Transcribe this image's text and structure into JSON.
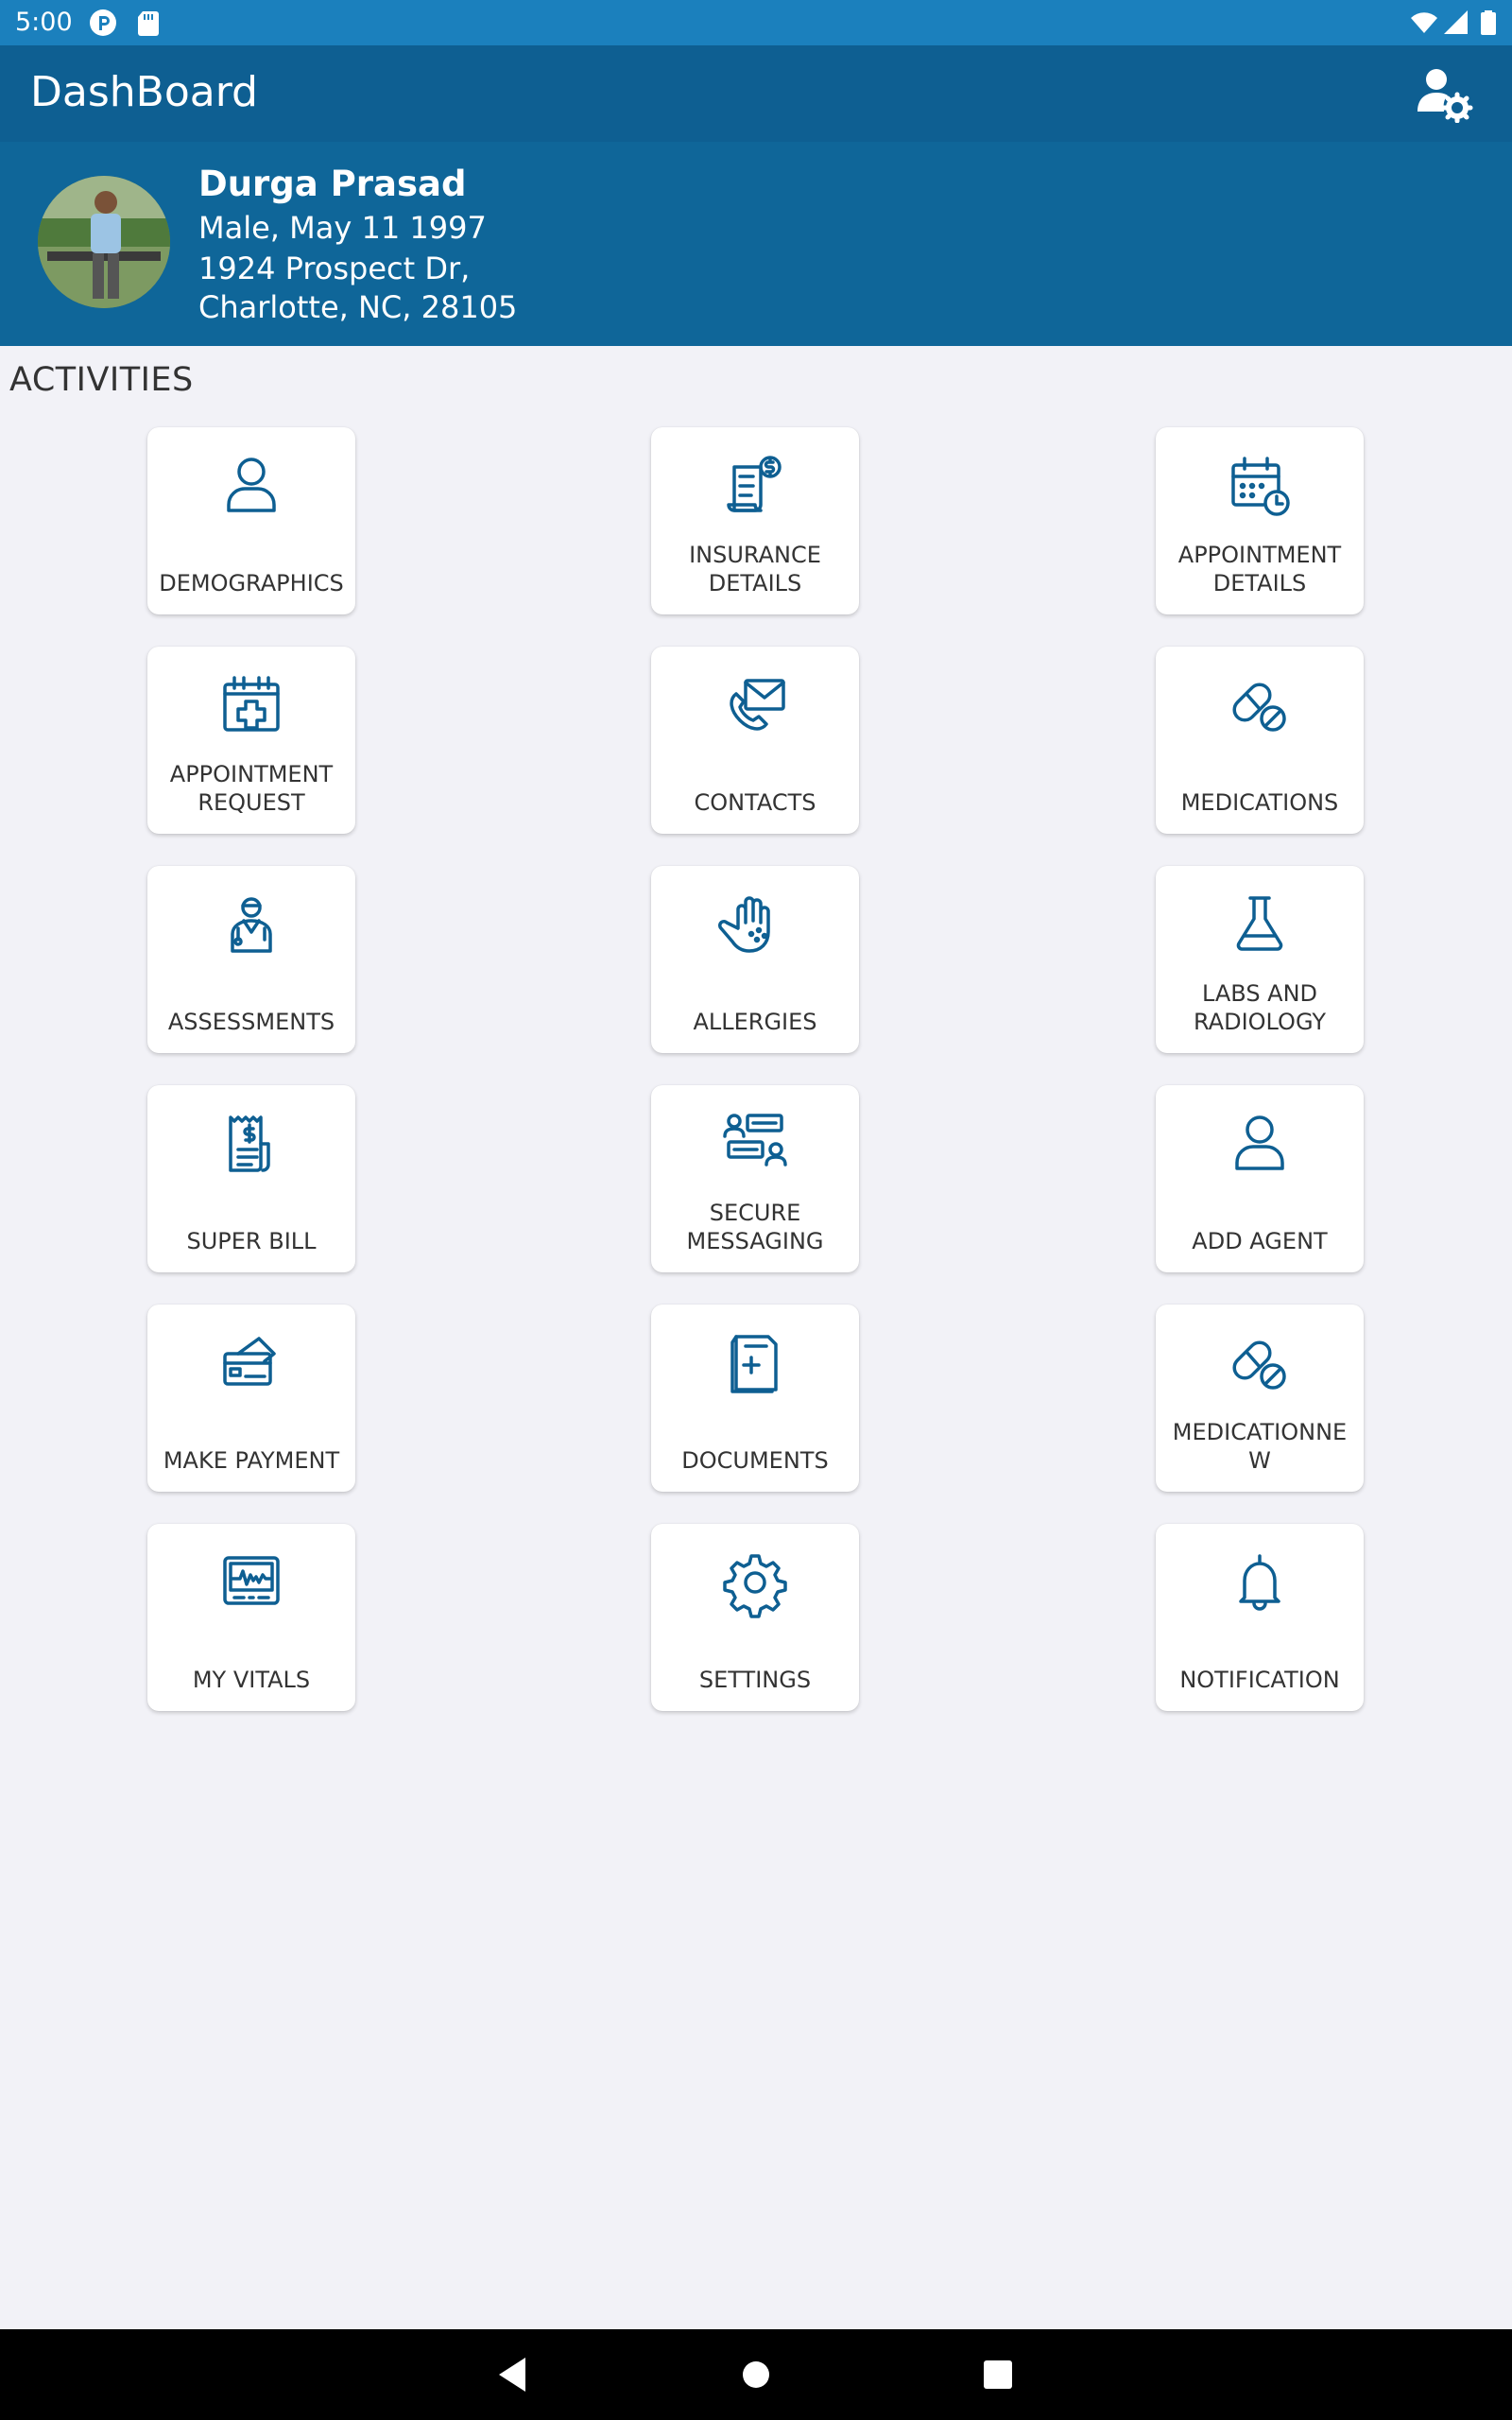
{
  "status_bar": {
    "time": "5:00",
    "left_icons": [
      "p-icon",
      "sd-card-icon"
    ],
    "right_icons": [
      "wifi-icon",
      "signal-icon",
      "battery-icon"
    ]
  },
  "app_bar": {
    "title": "DashBoard",
    "action_icon": "user-settings-icon"
  },
  "profile": {
    "name": "Durga Prasad",
    "gender_dob": "Male, May 11 1997",
    "address_line1": "1924 Prospect Dr,",
    "address_line2": "Charlotte, NC, 28105"
  },
  "activities_label": "ACTIVITIES",
  "activities": [
    {
      "label": "DEMOGRAPHICS",
      "icon": "user-icon"
    },
    {
      "label": "INSURANCE\nDETAILS",
      "icon": "insurance-icon"
    },
    {
      "label": "APPOINTMENT\nDETAILS",
      "icon": "calendar-clock-icon"
    },
    {
      "label": "APPOINTMENT\nREQUEST",
      "icon": "calendar-plus-icon"
    },
    {
      "label": "CONTACTS",
      "icon": "phone-mail-icon"
    },
    {
      "label": "MEDICATIONS",
      "icon": "pill-icon"
    },
    {
      "label": "ASSESSMENTS",
      "icon": "doctor-icon"
    },
    {
      "label": "ALLERGIES",
      "icon": "hand-icon"
    },
    {
      "label": "LABS AND\nRADIOLOGY",
      "icon": "flask-icon"
    },
    {
      "label": "SUPER BILL",
      "icon": "receipt-icon"
    },
    {
      "label": "SECURE\nMESSAGING",
      "icon": "chat-icon"
    },
    {
      "label": "ADD AGENT",
      "icon": "user-icon"
    },
    {
      "label": "MAKE PAYMENT",
      "icon": "credit-card-icon"
    },
    {
      "label": "DOCUMENTS",
      "icon": "document-icon"
    },
    {
      "label": "MEDICATIONNE\nW",
      "icon": "pill-icon"
    },
    {
      "label": "MY VITALS",
      "icon": "monitor-icon"
    },
    {
      "label": "SETTINGS",
      "icon": "gear-icon"
    },
    {
      "label": "NOTIFICATION",
      "icon": "bell-icon"
    }
  ],
  "nav_bar": {
    "icons": [
      "back-icon",
      "home-icon",
      "recents-icon"
    ]
  },
  "colors": {
    "primary": "#0e5f92",
    "status_bar": "#1b80bd",
    "profile_bg": "#0f6699",
    "icon": "#0e5f92",
    "background": "#f2f2f7"
  }
}
